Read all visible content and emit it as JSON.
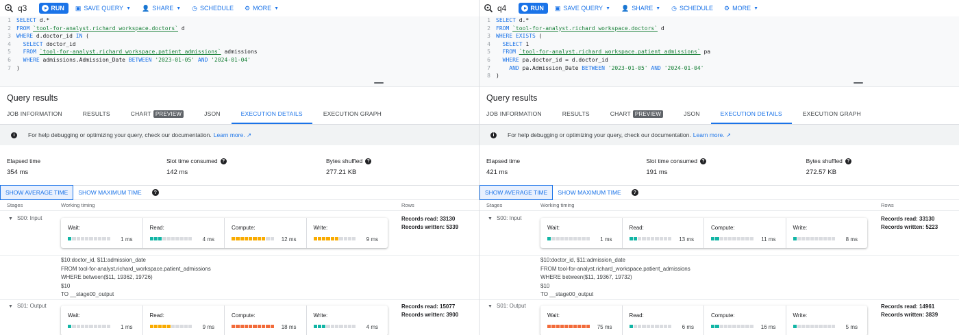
{
  "colors": {
    "accent": "#1a73e8",
    "teal": "#12b5a5",
    "yellow": "#f9ab00",
    "orange": "#f26b3a",
    "grey": "#dadce0"
  },
  "panels": [
    {
      "query_name": "q3",
      "toolbar": {
        "run": "RUN",
        "save": "SAVE QUERY",
        "share": "SHARE",
        "schedule": "SCHEDULE",
        "more": "MORE"
      },
      "code": [
        {
          "n": "1",
          "t": "SELECT d.*"
        },
        {
          "n": "2",
          "t": "FROM `tool-for-analyst.richard_workspace.doctors` d"
        },
        {
          "n": "3",
          "t": "WHERE d.doctor_id IN ("
        },
        {
          "n": "4",
          "t": "  SELECT doctor_id"
        },
        {
          "n": "5",
          "t": "  FROM `tool-for-analyst.richard_workspace.patient_admissions` admissions"
        },
        {
          "n": "6",
          "t": "  WHERE admissions.Admission_Date BETWEEN '2023-01-05' AND '2024-01-04'"
        },
        {
          "n": "7",
          "t": ")"
        }
      ],
      "results_title": "Query results",
      "tabs": [
        "JOB INFORMATION",
        "RESULTS",
        "CHART",
        "JSON",
        "EXECUTION DETAILS",
        "EXECUTION GRAPH"
      ],
      "preview_badge": "PREVIEW",
      "info_text": "For help debugging or optimizing your query, check our documentation.",
      "learn_more": "Learn more.",
      "metrics": [
        {
          "label": "Elapsed time",
          "value": "354 ms"
        },
        {
          "label": "Slot time consumed",
          "value": "142 ms"
        },
        {
          "label": "Bytes shuffled",
          "value": "277.21 KB"
        }
      ],
      "toggle": {
        "avg": "SHOW AVERAGE TIME",
        "max": "SHOW MAXIMUM TIME"
      },
      "columns": {
        "stages": "Stages",
        "timing": "Working timing",
        "rows": "Rows"
      },
      "stages": [
        {
          "name": "S00: Input",
          "timings": [
            {
              "label": "Wait:",
              "value": "1 ms",
              "fill": 0.1,
              "color": "teal"
            },
            {
              "label": "Read:",
              "value": "4 ms",
              "fill": 0.25,
              "color": "teal"
            },
            {
              "label": "Compute:",
              "value": "12 ms",
              "fill": 0.75,
              "color": "yellow"
            },
            {
              "label": "Write:",
              "value": "9 ms",
              "fill": 0.55,
              "color": "yellow"
            }
          ],
          "records_read": "Records read: 33130",
          "records_written": "Records written: 5339",
          "details": [
            "$10:doctor_id, $11:admission_date",
            "FROM tool-for-analyst.richard_workspace.patient_admissions",
            "WHERE between($11, 19362, 19726)",
            "$10",
            "TO __stage00_output"
          ]
        },
        {
          "name": "S01: Output",
          "timings": [
            {
              "label": "Wait:",
              "value": "1 ms",
              "fill": 0.1,
              "color": "teal"
            },
            {
              "label": "Read:",
              "value": "9 ms",
              "fill": 0.5,
              "color": "yellow"
            },
            {
              "label": "Compute:",
              "value": "18 ms",
              "fill": 1.0,
              "color": "orange"
            },
            {
              "label": "Write:",
              "value": "4 ms",
              "fill": 0.25,
              "color": "teal"
            }
          ],
          "records_read": "Records read: 15077",
          "records_written": "Records written: 3900",
          "details": []
        }
      ]
    },
    {
      "query_name": "q4",
      "toolbar": {
        "run": "RUN",
        "save": "SAVE QUERY",
        "share": "SHARE",
        "schedule": "SCHEDULE",
        "more": "MORE"
      },
      "code": [
        {
          "n": "1",
          "t": "SELECT d.*"
        },
        {
          "n": "2",
          "t": "FROM `tool-for-analyst.richard_workspace.doctors` d"
        },
        {
          "n": "3",
          "t": "WHERE EXISTS ("
        },
        {
          "n": "4",
          "t": "  SELECT 1"
        },
        {
          "n": "5",
          "t": "  FROM `tool-for-analyst.richard_workspace.patient_admissions` pa"
        },
        {
          "n": "6",
          "t": "  WHERE pa.doctor_id = d.doctor_id"
        },
        {
          "n": "7",
          "t": "    AND pa.Admission_Date BETWEEN '2023-01-05' AND '2024-01-04'"
        },
        {
          "n": "8",
          "t": ")"
        }
      ],
      "results_title": "Query results",
      "tabs": [
        "JOB INFORMATION",
        "RESULTS",
        "CHART",
        "JSON",
        "EXECUTION DETAILS",
        "EXECUTION GRAPH"
      ],
      "preview_badge": "PREVIEW",
      "info_text": "For help debugging or optimizing your query, check our documentation.",
      "learn_more": "Learn more.",
      "metrics": [
        {
          "label": "Elapsed time",
          "value": "421 ms"
        },
        {
          "label": "Slot time consumed",
          "value": "191 ms"
        },
        {
          "label": "Bytes shuffled",
          "value": "272.57 KB"
        }
      ],
      "toggle": {
        "avg": "SHOW AVERAGE TIME",
        "max": "SHOW MAXIMUM TIME"
      },
      "columns": {
        "stages": "Stages",
        "timing": "Working timing",
        "rows": "Rows"
      },
      "stages": [
        {
          "name": "S00: Input",
          "timings": [
            {
              "label": "Wait:",
              "value": "1 ms",
              "fill": 0.05,
              "color": "teal"
            },
            {
              "label": "Read:",
              "value": "13 ms",
              "fill": 0.2,
              "color": "teal"
            },
            {
              "label": "Compute:",
              "value": "11 ms",
              "fill": 0.15,
              "color": "teal"
            },
            {
              "label": "Write:",
              "value": "8 ms",
              "fill": 0.1,
              "color": "teal"
            }
          ],
          "records_read": "Records read: 33130",
          "records_written": "Records written: 5223",
          "details": [
            "$10:doctor_id, $11:admission_date",
            "FROM tool-for-analyst.richard_workspace.patient_admissions",
            "WHERE between($11, 19367, 19732)",
            "$10",
            "TO __stage00_output"
          ]
        },
        {
          "name": "S01: Output",
          "timings": [
            {
              "label": "Wait:",
              "value": "75 ms",
              "fill": 1.0,
              "color": "orange"
            },
            {
              "label": "Read:",
              "value": "6 ms",
              "fill": 0.1,
              "color": "teal"
            },
            {
              "label": "Compute:",
              "value": "16 ms",
              "fill": 0.2,
              "color": "teal"
            },
            {
              "label": "Write:",
              "value": "5 ms",
              "fill": 0.1,
              "color": "teal"
            }
          ],
          "records_read": "Records read: 14961",
          "records_written": "Records written: 3839",
          "details": []
        }
      ]
    }
  ]
}
